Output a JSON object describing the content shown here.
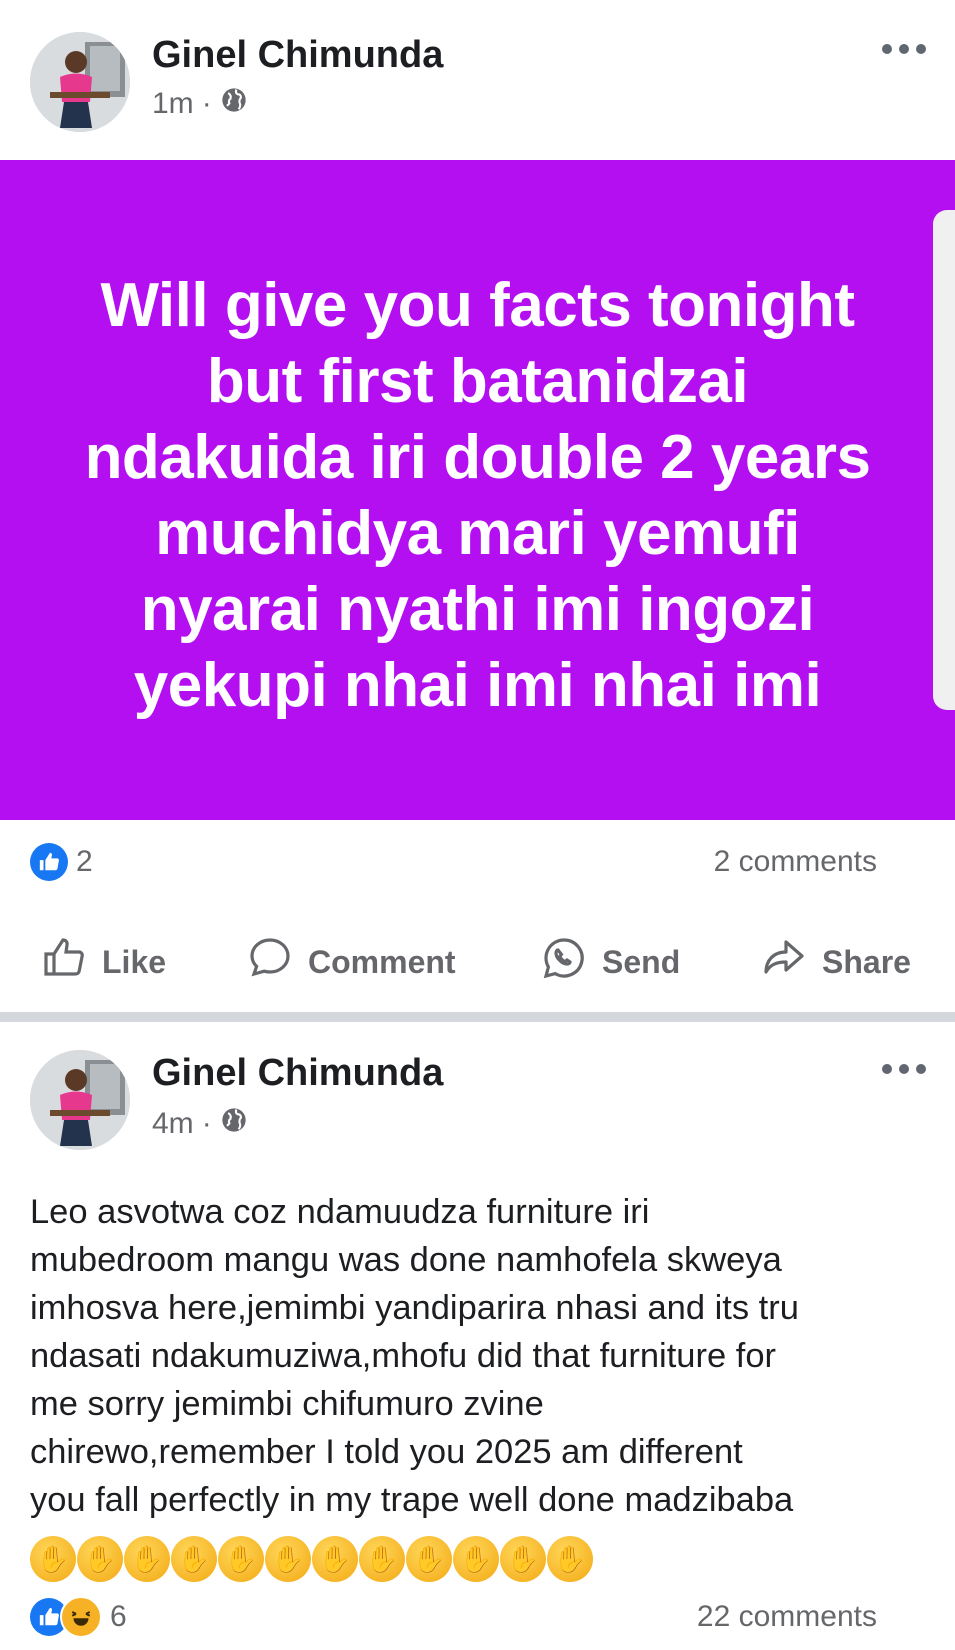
{
  "post1": {
    "author": "Ginel Chimunda",
    "time": "1m",
    "separator": "·",
    "audience_icon": "globe-icon",
    "banner_color": "#b30ff0",
    "banner_lines": [
      "Will give you facts tonight",
      "but first batanidzai",
      "ndakuida iri double 2 years",
      "muchidya mari yemufi",
      "nyarai nyathi imi ingozi",
      "yekupi nhai imi nhai imi"
    ],
    "reaction_count": "2",
    "comments_count": "2 comments",
    "actions": {
      "like": "Like",
      "comment": "Comment",
      "send": "Send",
      "share": "Share"
    }
  },
  "post2": {
    "author": "Ginel Chimunda",
    "time": "4m",
    "separator": "·",
    "audience_icon": "globe-icon",
    "body_lines": [
      "Leo asvotwa coz ndamuudza furniture iri",
      "mubedroom mangu was done namhofela skweya",
      "imhosva here,jemimbi yandiparira nhasi and its tru",
      "ndasati ndakumuziwa,mhofu did that furniture for",
      "me sorry jemimbi chifumuro zvine",
      "chirewo,remember I told you 2025 am different",
      "you fall perfectly in my trape well done madzibaba"
    ],
    "emoji_icon": "clapping-hands-icon",
    "emoji_count": 12,
    "reaction_count": "6",
    "comments_count": "22 comments"
  },
  "colors": {
    "like_blue": "#1877f2",
    "haha_yellow": "#f7b125",
    "secondary_text": "#65676b"
  }
}
